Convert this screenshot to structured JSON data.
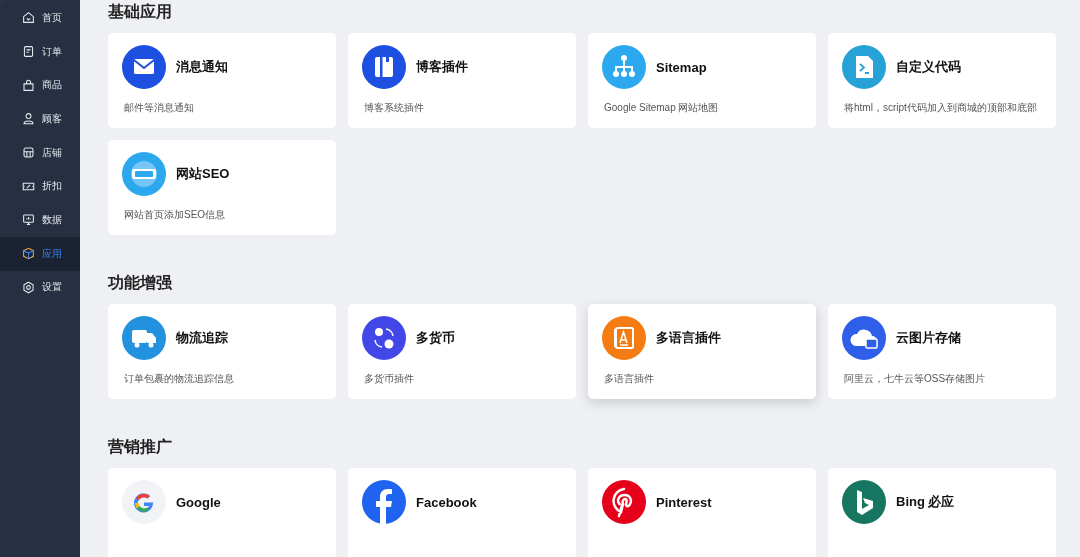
{
  "sidebar": {
    "items": [
      {
        "label": "首页",
        "kind": "home",
        "selected": false
      },
      {
        "label": "订单",
        "kind": "order",
        "selected": false
      },
      {
        "label": "商品",
        "kind": "bag",
        "selected": false
      },
      {
        "label": "顾客",
        "kind": "user",
        "selected": false
      },
      {
        "label": "店铺",
        "kind": "store",
        "selected": false
      },
      {
        "label": "折扣",
        "kind": "ticket",
        "selected": false
      },
      {
        "label": "数据",
        "kind": "monitor",
        "selected": false
      },
      {
        "label": "应用",
        "kind": "box",
        "selected": true
      },
      {
        "label": "设置",
        "kind": "gear",
        "selected": false
      }
    ]
  },
  "sections": [
    {
      "title": "基础应用",
      "apps": [
        {
          "name": "消息通知",
          "description": "邮件等消息通知",
          "kind": "mail",
          "color": "#1d4fe0",
          "highlighted": false
        },
        {
          "name": "博客插件",
          "description": "博客系统插件",
          "kind": "book",
          "color": "#1d4fe0",
          "highlighted": false
        },
        {
          "name": "Sitemap",
          "description": "Google Sitemap 网站地图",
          "kind": "tree",
          "color": "#2ba8ee",
          "highlighted": false
        },
        {
          "name": "自定义代码",
          "description": "将html，script代码加入到商城的顶部和底部",
          "kind": "code",
          "color": "#27a2d6",
          "highlighted": false
        },
        {
          "name": "网站SEO",
          "description": "网站首页添加SEO信息",
          "kind": "seo",
          "color": "#2ba8ee",
          "highlighted": false
        }
      ]
    },
    {
      "title": "功能增强",
      "apps": [
        {
          "name": "物流追踪",
          "description": "订单包裹的物流追踪信息",
          "kind": "truck",
          "color": "#2291de",
          "highlighted": false
        },
        {
          "name": "多货币",
          "description": "多货币插件",
          "kind": "currency",
          "color": "#4347e8",
          "highlighted": false
        },
        {
          "name": "多语言插件",
          "description": "多语言插件",
          "kind": "letter",
          "color": "#f47c12",
          "highlighted": true
        },
        {
          "name": "云图片存储",
          "description": "阿里云，七牛云等OSS存储图片",
          "kind": "cloud",
          "color": "#2f5fe8",
          "highlighted": false
        }
      ]
    },
    {
      "title": "营销推广",
      "apps": [
        {
          "name": "Google",
          "kind": "google",
          "color": "#f1f3f6",
          "highlighted": false
        },
        {
          "name": "Facebook",
          "kind": "facebook",
          "color": "#1f63f0",
          "highlighted": false
        },
        {
          "name": "Pinterest",
          "kind": "pinterest",
          "color": "#e60019",
          "highlighted": false
        },
        {
          "name": "Bing 必应",
          "kind": "bing",
          "color": "#167660",
          "highlighted": false
        }
      ]
    }
  ]
}
